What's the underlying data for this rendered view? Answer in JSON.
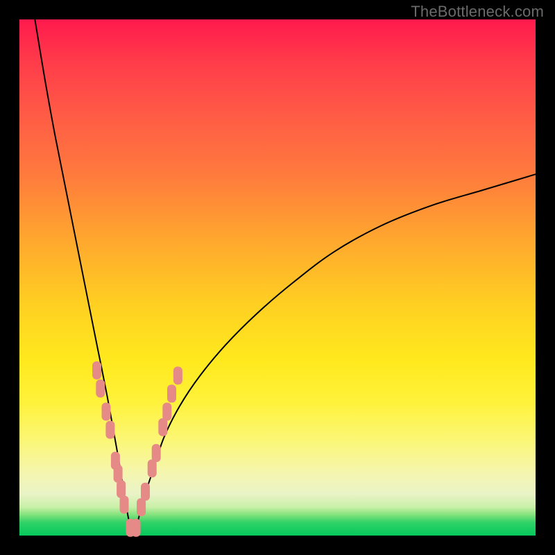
{
  "watermark": "TheBottleneck.com",
  "chart_data": {
    "type": "line",
    "title": "",
    "xlabel": "",
    "ylabel": "",
    "xlim": [
      0,
      100
    ],
    "ylim": [
      0,
      100
    ],
    "grid": false,
    "legend": false,
    "description": "Bottleneck curve: a single black V-shaped curve on a vertical red→green gradient. The minimum (best / green) occurs near x≈22 at y≈0. Left branch rises steeply to y≈100 at x≈3; right branch rises more gradually to y≈70 at x≈100. Salmon-colored rounded rectangles mark sample points along both branches near the trough.",
    "series": [
      {
        "name": "bottleneck",
        "x": [
          3,
          5,
          7,
          10,
          13,
          15,
          17,
          19,
          20,
          21,
          22,
          23,
          24,
          26,
          28,
          31,
          35,
          40,
          46,
          53,
          61,
          70,
          80,
          90,
          100
        ],
        "y": [
          100,
          88,
          77,
          62,
          47,
          37,
          27,
          16,
          10,
          4,
          0,
          3,
          7,
          13,
          19,
          25,
          31,
          37,
          43,
          49,
          55,
          60,
          64,
          67,
          70
        ]
      }
    ],
    "markers": {
      "comment": "Salmon rounded-rect markers clustered on both sides of the trough, roughly from y≈7 to y≈30 on each branch plus a couple at the very bottom.",
      "points_x": [
        15.0,
        15.7,
        16.8,
        17.6,
        18.6,
        19.1,
        19.7,
        20.3,
        21.5,
        22.6,
        23.6,
        24.4,
        25.7,
        26.5,
        27.8,
        28.6,
        29.5,
        30.7
      ],
      "points_y": [
        32.0,
        28.5,
        24.0,
        20.5,
        14.5,
        12.0,
        9.0,
        6.0,
        1.5,
        1.5,
        5.5,
        8.5,
        13.0,
        16.0,
        21.0,
        24.0,
        27.5,
        31.0
      ],
      "color": "#e58a86"
    },
    "gradient_stops": [
      {
        "pos": 0,
        "color": "#ff1a4d"
      },
      {
        "pos": 0.3,
        "color": "#ff7a3d"
      },
      {
        "pos": 0.55,
        "color": "#ffcf22"
      },
      {
        "pos": 0.82,
        "color": "#fbf77a"
      },
      {
        "pos": 0.96,
        "color": "#81e27b"
      },
      {
        "pos": 1.0,
        "color": "#05c85c"
      }
    ]
  }
}
